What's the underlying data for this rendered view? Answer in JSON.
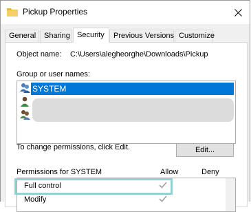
{
  "window": {
    "title": "Pickup Properties"
  },
  "tabs": [
    {
      "label": "General"
    },
    {
      "label": "Sharing"
    },
    {
      "label": "Security"
    },
    {
      "label": "Previous Versions"
    },
    {
      "label": "Customize"
    }
  ],
  "object": {
    "label": "Object name:",
    "value": "C:\\Users\\alegheorghe\\Downloads\\Pickup"
  },
  "groups": {
    "label": "Group or user names:",
    "items": [
      {
        "name": "SYSTEM",
        "icon": "users-group-icon",
        "selected": true
      },
      {
        "name": "",
        "icon": "user-icon",
        "redacted": true
      },
      {
        "name": "",
        "icon": "users-group-icon",
        "redacted": true
      }
    ]
  },
  "change_text": "To change permissions, click Edit.",
  "edit_button": "Edit...",
  "permissions": {
    "label": "Permissions for SYSTEM",
    "allow": "Allow",
    "deny": "Deny",
    "rows": [
      {
        "name": "Full control",
        "allow": true,
        "deny": false
      },
      {
        "name": "Modify",
        "allow": true,
        "deny": false
      }
    ]
  },
  "colors": {
    "selection": "#0078d7",
    "highlight": "#8fd3d3",
    "check": "#a0a0a0"
  }
}
